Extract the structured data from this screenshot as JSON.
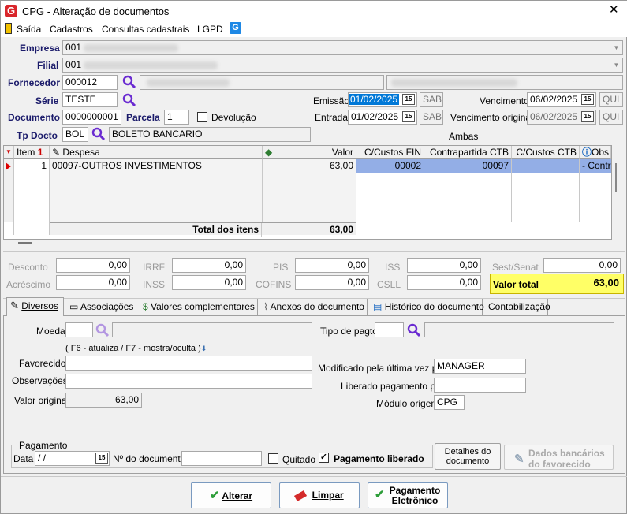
{
  "window": {
    "title": "CPG - Alteração de documentos",
    "close": "✕"
  },
  "menu": [
    "Saída",
    "Cadastros",
    "Consultas cadastrais",
    "LGPD"
  ],
  "header": {
    "empresa": {
      "label": "Empresa",
      "value": "001"
    },
    "filial": {
      "label": "Filial",
      "value": "001"
    },
    "fornecedor": {
      "label": "Fornecedor",
      "value": "000012"
    },
    "serie": {
      "label": "Série",
      "value": "TESTE"
    },
    "emissao": {
      "label": "Emissão",
      "value": "01/02/2025",
      "day": "SAB"
    },
    "vencimento": {
      "label": "Vencimento",
      "value": "06/02/2025",
      "day": "QUI"
    },
    "documento": {
      "label": "Documento",
      "value": "0000000001"
    },
    "parcela": {
      "label": "Parcela",
      "value": "1"
    },
    "devolucao": {
      "label": "Devolução"
    },
    "entrada": {
      "label": "Entrada",
      "value": "01/02/2025",
      "day": "SAB"
    },
    "vencimento_original": {
      "label": "Vencimento original",
      "value": "06/02/2025",
      "day": "QUI"
    },
    "tp_docto": {
      "label": "Tp Docto",
      "value": "BOL",
      "desc": "BOLETO BANCARIO"
    },
    "ambas": "Ambas"
  },
  "grid": {
    "columns": [
      "Item",
      "Despesa",
      "Valor",
      "C/Custos FIN",
      "Contrapartida CTB",
      "C/Custos CTB",
      "Obs"
    ],
    "sort_indicator": "1",
    "rows": [
      {
        "item": "1",
        "despesa": "00097-OUTROS INVESTIMENTOS",
        "valor": "63,00",
        "cc_fin": "00002",
        "contrapartida": "00097",
        "cc_ctb": "",
        "obs": "- Contra"
      }
    ],
    "total_label": "Total dos itens",
    "total_value": "63,00"
  },
  "taxes": {
    "desconto": {
      "label": "Desconto",
      "value": "0,00"
    },
    "irrf": {
      "label": "IRRF",
      "value": "0,00"
    },
    "pis": {
      "label": "PIS",
      "value": "0,00"
    },
    "iss": {
      "label": "ISS",
      "value": "0,00"
    },
    "sest": {
      "label": "Sest/Senat",
      "value": "0,00"
    },
    "acrescimo": {
      "label": "Acréscimo",
      "value": "0,00"
    },
    "inss": {
      "label": "INSS",
      "value": "0,00"
    },
    "cofins": {
      "label": "COFINS",
      "value": "0,00"
    },
    "csll": {
      "label": "CSLL",
      "value": "0,00"
    },
    "valor_total": {
      "label": "Valor total",
      "value": "63,00"
    }
  },
  "tabs": [
    "Diversos",
    "Associações",
    "Valores complementares",
    "Anexos do documento",
    "Histórico do documento",
    "Contabilização"
  ],
  "diversos": {
    "moeda": "Moeda",
    "tipo_pagto": "Tipo de pagto",
    "hint": "( F6 - atualiza / F7 - mostra/oculta )",
    "favorecido": "Favorecido",
    "observacoes": "Observações",
    "valor_original": {
      "label": "Valor original",
      "value": "63,00"
    },
    "modificado": {
      "label": "Modificado pela última vez por",
      "value": "MANAGER"
    },
    "liberado": {
      "label": "Liberado pagamento por",
      "value": ""
    },
    "modulo": {
      "label": "Módulo origem",
      "value": "CPG"
    }
  },
  "pagamento": {
    "legend": "Pagamento",
    "data_label": "Data",
    "data_value": " /  /",
    "ndoc_label": "Nº do documento",
    "quitado": "Quitado",
    "liberado": "Pagamento liberado",
    "detalhes": [
      "Detalhes do",
      "documento"
    ],
    "dados_bancarios": [
      "Dados bancários",
      "do favorecido"
    ]
  },
  "buttons": {
    "alterar": "Alterar",
    "limpar": "Limpar",
    "pagamento": [
      "Pagamento",
      "Eletrônico"
    ]
  },
  "colors": {
    "accent": "#0078d7",
    "total_bg": "#ffff66",
    "title_icon": "#d9262b"
  }
}
